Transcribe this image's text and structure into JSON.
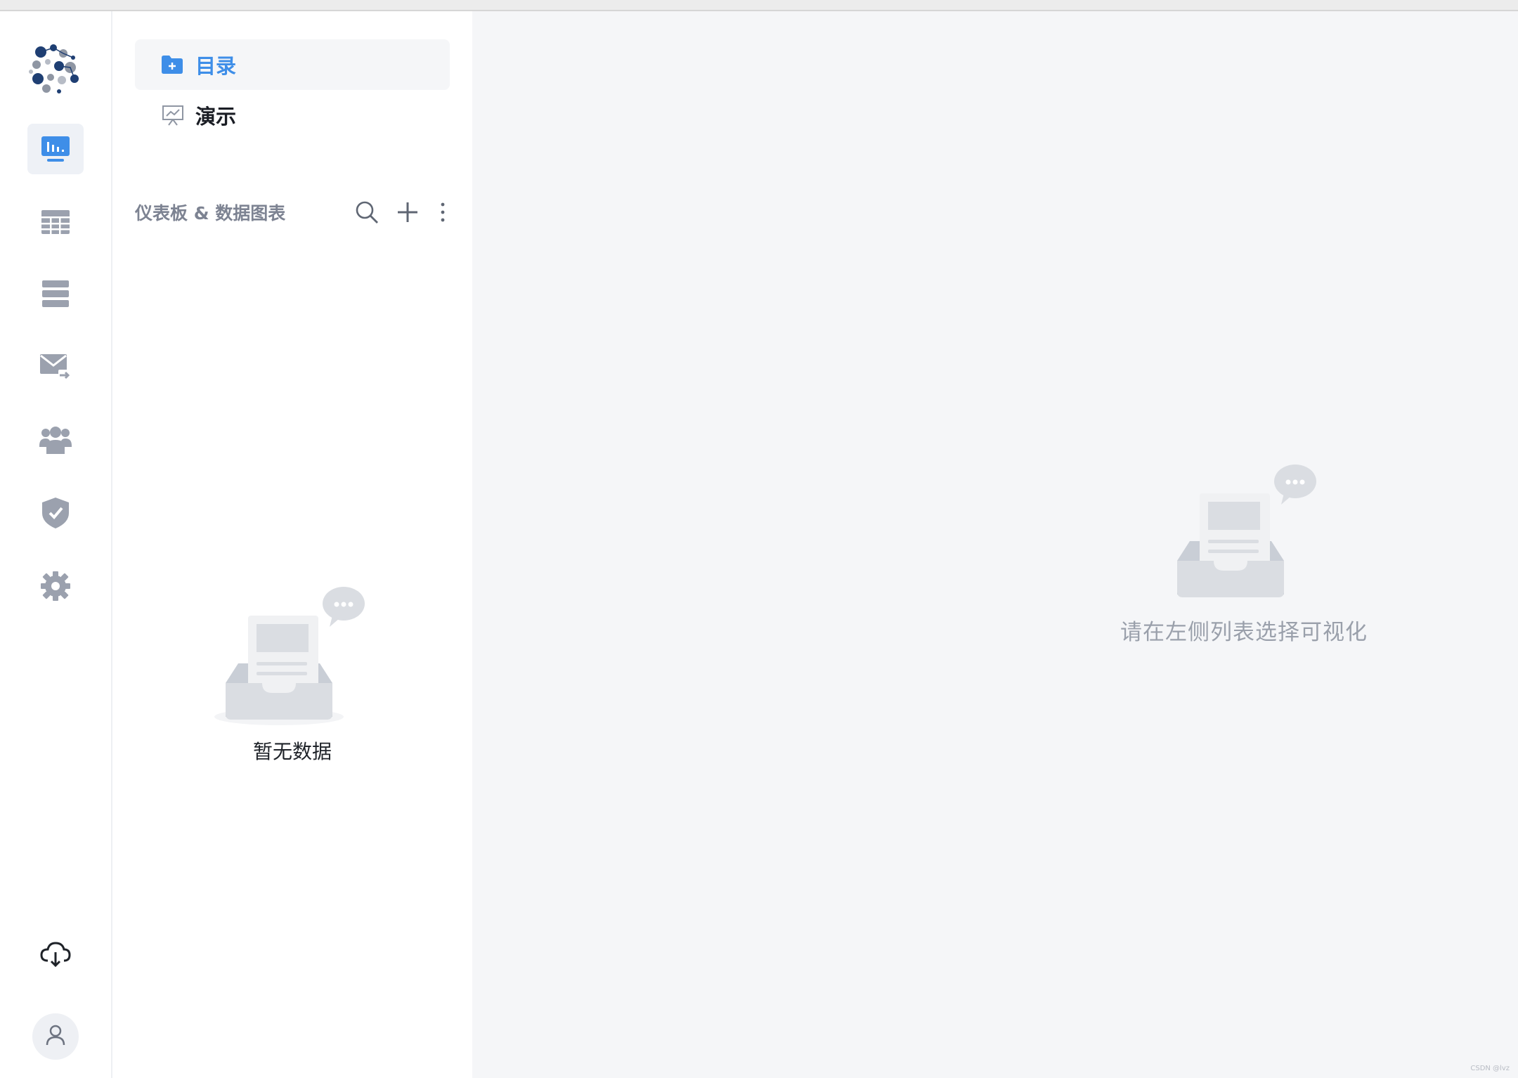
{
  "nav": {
    "items": [
      {
        "label": "目录",
        "icon": "folder-plus-icon",
        "selected": true
      },
      {
        "label": "演示",
        "icon": "presentation-icon",
        "selected": false
      }
    ]
  },
  "section": {
    "title": "仪表板 & 数据图表",
    "actions": [
      "search-icon",
      "plus-icon",
      "more-vertical-icon"
    ]
  },
  "sidebar_empty": {
    "text": "暂无数据"
  },
  "main_empty": {
    "text": "请在左侧列表选择可视化"
  },
  "rail": {
    "items": [
      "dashboard-icon",
      "table-icon",
      "database-icon",
      "mail-share-icon",
      "users-icon",
      "shield-check-icon",
      "settings-icon"
    ],
    "bottom": [
      "cloud-download-icon",
      "user-icon"
    ]
  },
  "watermark": "CSDN @lvz",
  "colors": {
    "accent": "#3e8ee8",
    "rail_icon": "#9ba1ae",
    "main_bg": "#f5f6f8"
  }
}
